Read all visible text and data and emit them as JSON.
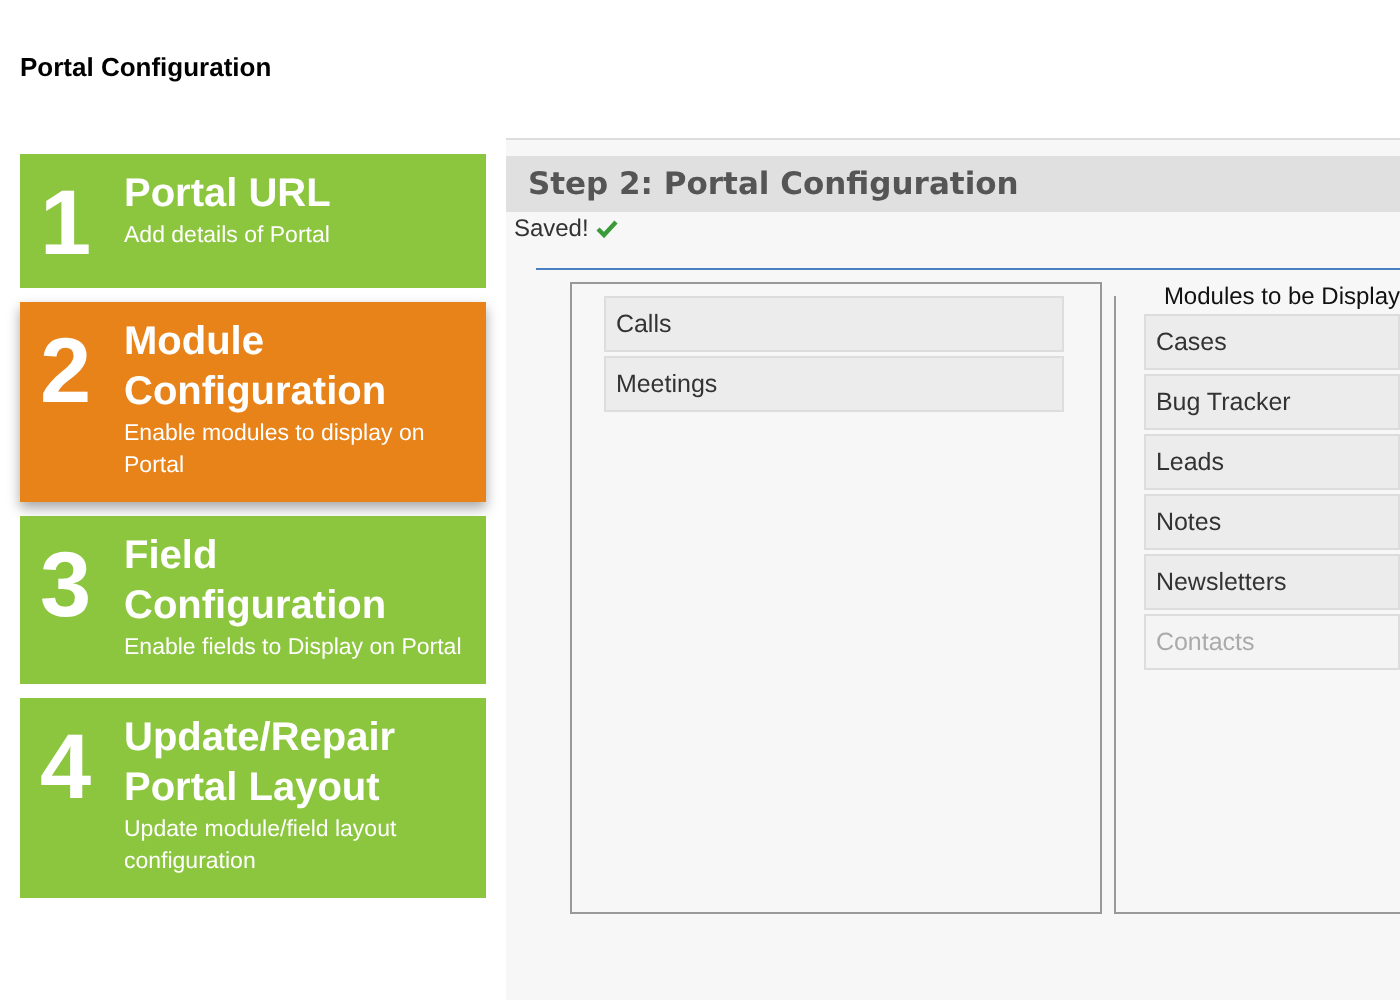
{
  "page_title": "Portal Configuration",
  "steps": [
    {
      "number": "1",
      "title": "Portal URL",
      "description": "Add details of Portal",
      "selected": false
    },
    {
      "number": "2",
      "title": "Module Configuration",
      "description": "Enable modules to display on Portal",
      "selected": true
    },
    {
      "number": "3",
      "title": "Field Configuration",
      "description": "Enable fields to Display on Portal",
      "selected": false
    },
    {
      "number": "4",
      "title": "Update/Repair Portal Layout",
      "description": "Update module/field layout configuration",
      "selected": false
    }
  ],
  "panel": {
    "title": "Step 2: Portal Configuration",
    "status": "Saved!",
    "hidden_modules": [
      {
        "label": "Calls"
      },
      {
        "label": "Meetings"
      }
    ],
    "displayed_modules_legend": "Modules to be Display",
    "displayed_modules": [
      {
        "label": "Cases",
        "disabled": false
      },
      {
        "label": "Bug Tracker",
        "disabled": false
      },
      {
        "label": "Leads",
        "disabled": false
      },
      {
        "label": "Notes",
        "disabled": false
      },
      {
        "label": "Newsletters",
        "disabled": false
      },
      {
        "label": "Contacts",
        "disabled": true
      }
    ]
  }
}
